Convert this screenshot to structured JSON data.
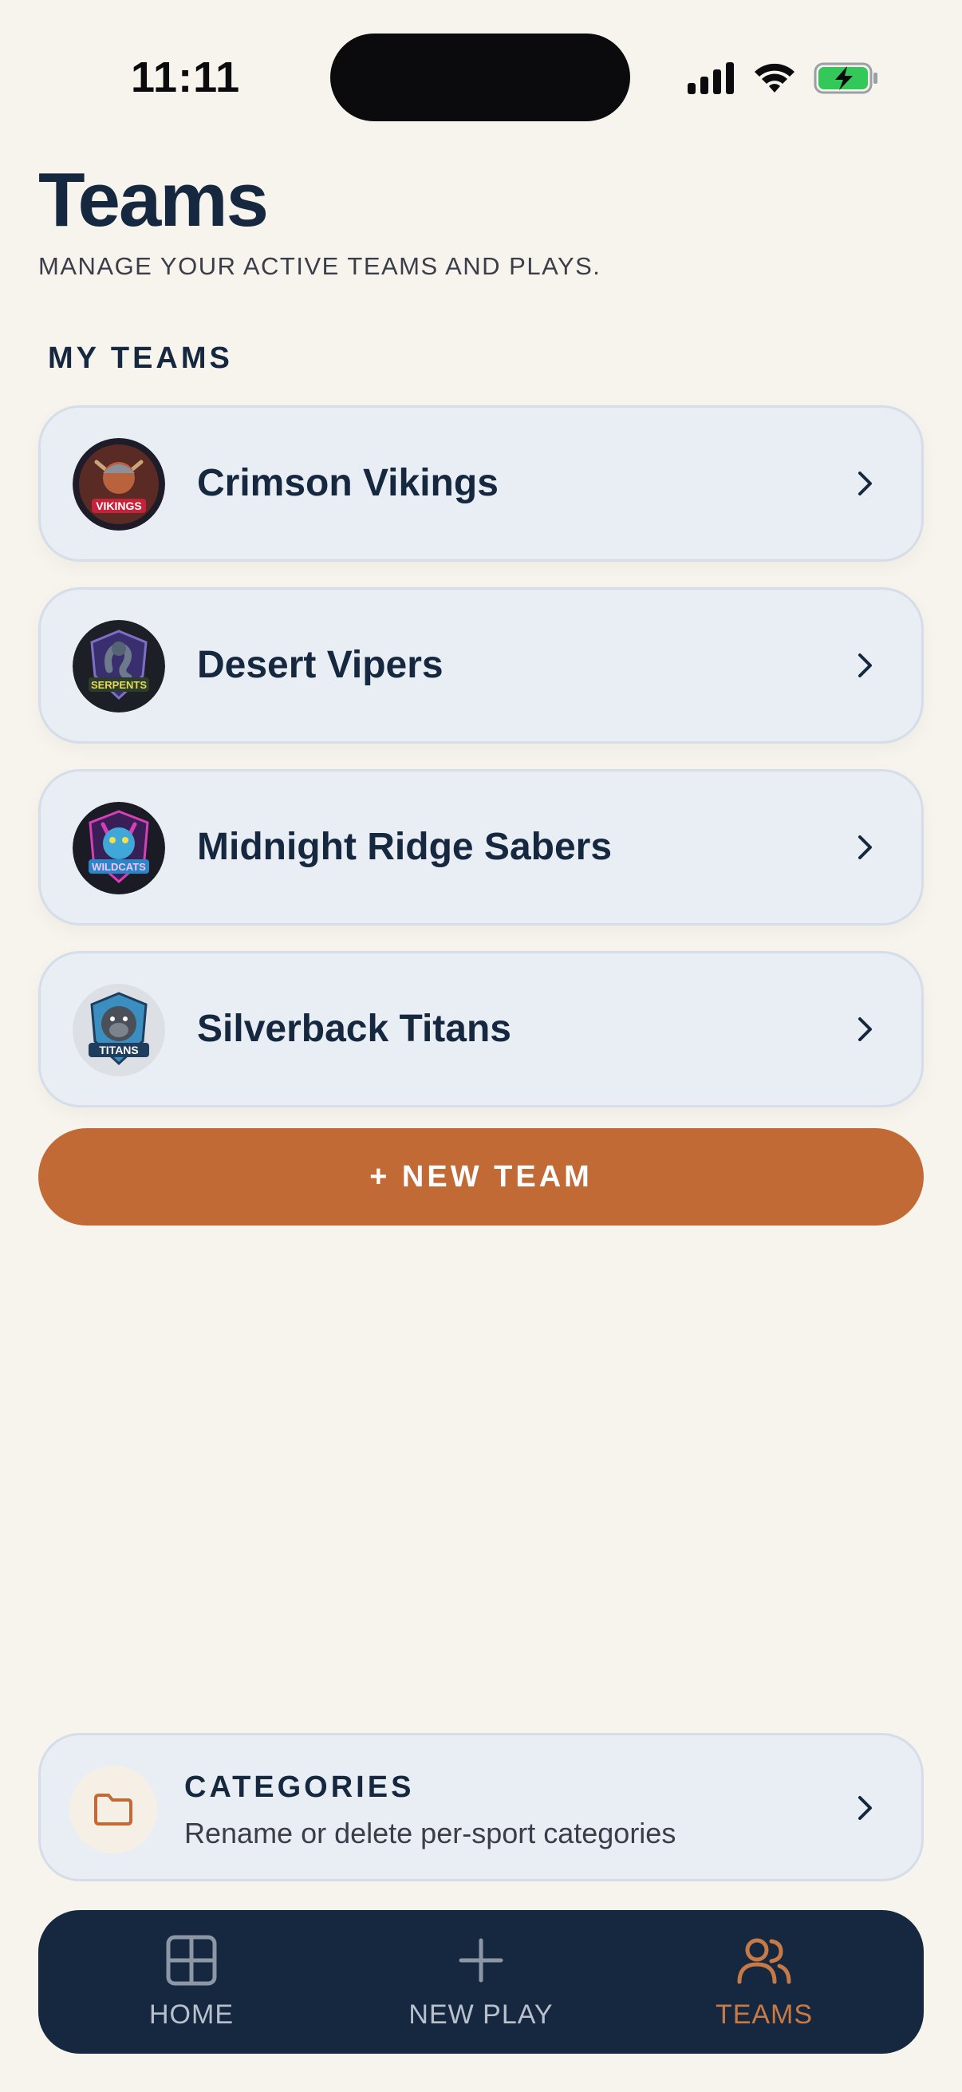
{
  "status_bar": {
    "time": "11:11"
  },
  "header": {
    "title": "Teams",
    "subtitle": "MANAGE YOUR ACTIVE TEAMS AND PLAYS."
  },
  "section": {
    "label": "MY TEAMS"
  },
  "teams": [
    {
      "name": "Crimson Vikings",
      "logo_text": "VIKINGS"
    },
    {
      "name": "Desert Vipers",
      "logo_text": "SERPENTS"
    },
    {
      "name": "Midnight Ridge Sabers",
      "logo_text": "WILDCATS"
    },
    {
      "name": "Silverback Titans",
      "logo_text": "TITANS"
    }
  ],
  "new_team_button": {
    "label": "+ NEW TEAM"
  },
  "categories": {
    "title": "CATEGORIES",
    "description": "Rename or delete per-sport categories"
  },
  "bottom_nav": {
    "items": [
      {
        "label": "HOME",
        "icon": "grid-icon"
      },
      {
        "label": "NEW PLAY",
        "icon": "plus-icon"
      },
      {
        "label": "TEAMS",
        "icon": "users-icon",
        "active": true
      }
    ]
  },
  "colors": {
    "background": "#f7f4ee",
    "navy": "#16283f",
    "accent": "#c16a36",
    "card": "#e9eef5"
  }
}
